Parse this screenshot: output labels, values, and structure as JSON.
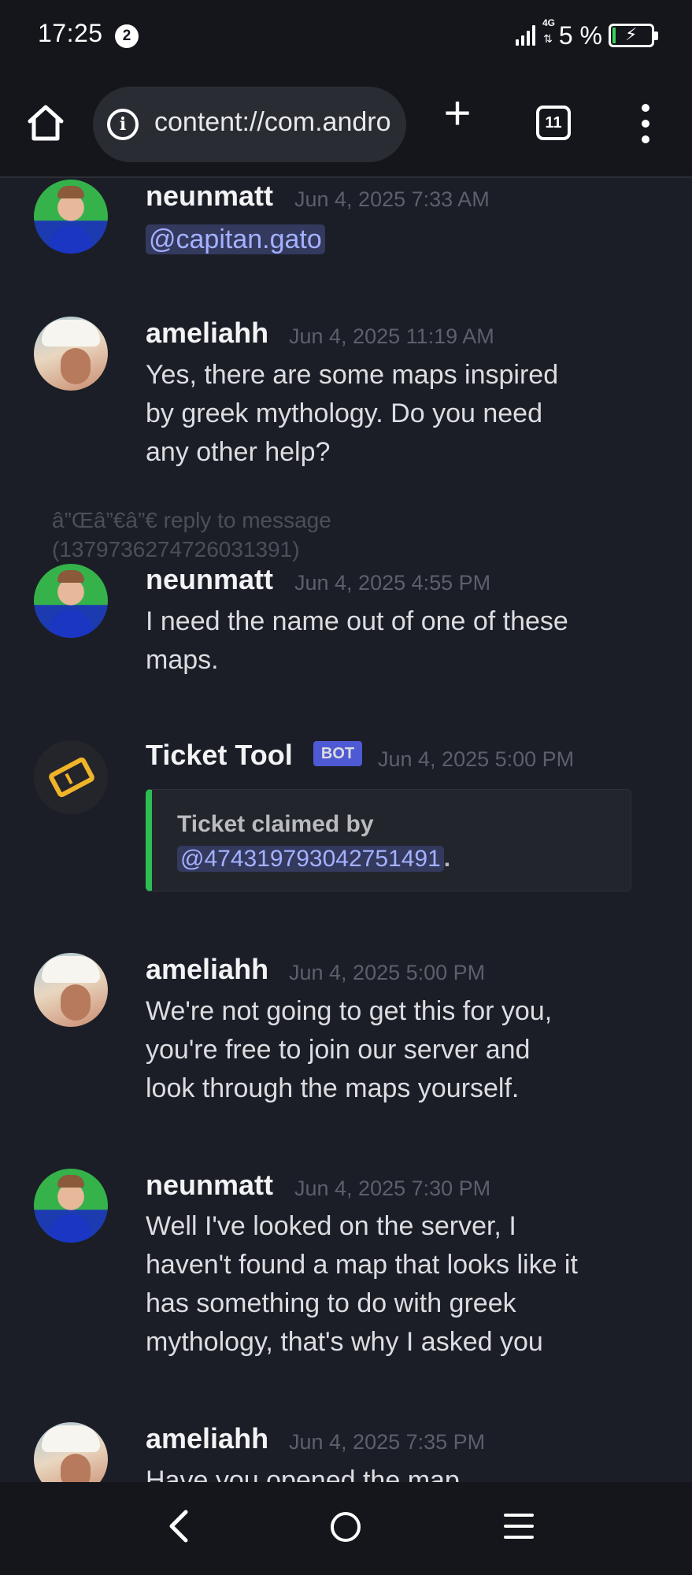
{
  "status": {
    "time": "17:25",
    "notification_count": "2",
    "network": "4G",
    "battery": "5 %",
    "battery_level": 0.05
  },
  "browser": {
    "url": "content://com.android.chrome",
    "tab_count": "11"
  },
  "messages": [
    {
      "user": "neunmatt",
      "time": "Jun 4, 2025 7:33 AM",
      "mention": "@capitan.gato"
    },
    {
      "user": "ameliahh",
      "time": "Jun 4, 2025 11:19 AM",
      "text_lines": [
        "Yes, there are some maps inspired",
        "by greek mythology. Do you need",
        "any other help?"
      ]
    },
    {
      "reply_marker_lines": [
        "â”Œâ”€â”€ reply to message",
        "(1379736274726031391)"
      ]
    },
    {
      "user": "neunmatt",
      "time": "Jun 4, 2025 4:55 PM",
      "text_lines": [
        "I need the name out of one of these",
        "maps."
      ]
    },
    {
      "user": "Ticket Tool",
      "badge": "BOT",
      "time": "Jun 4, 2025 5:00 PM",
      "embed_line1": "Ticket claimed by",
      "embed_mention": "@474319793042751491",
      "embed_suffix": "."
    },
    {
      "user": "ameliahh",
      "time": "Jun 4, 2025 5:00 PM",
      "text_lines": [
        "We're not going to get this for you,",
        "you're free to join our server and",
        "look through the maps yourself."
      ]
    },
    {
      "user": "neunmatt",
      "time": "Jun 4, 2025 7:30 PM",
      "text_lines": [
        "Well I've looked on the server, I",
        "haven't found a map that looks like it",
        "has something to do with greek",
        "mythology, that's why I asked you"
      ]
    },
    {
      "user": "ameliahh",
      "time": "Jun 4, 2025 7:35 PM",
      "text_lines": [
        "Have you opened the map"
      ]
    }
  ],
  "colors": {
    "background": "#1b1e26",
    "mention_bg": "#34395e",
    "mention_text": "#a4b1ff",
    "embed_accent": "#2ebd55",
    "bot_badge": "#5865f2"
  }
}
